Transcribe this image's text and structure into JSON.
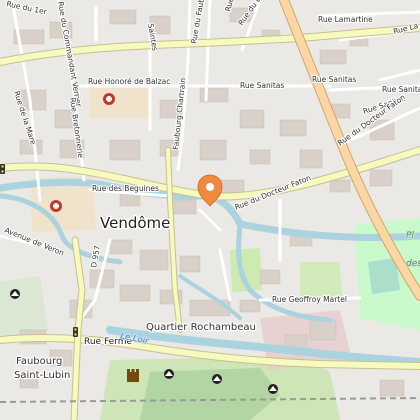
{
  "map": {
    "town": "Vendôme",
    "districts": [
      "Quartier Rochambeau",
      "Faubourg",
      "Saint-Lubin"
    ],
    "streets": {
      "rue_1er": "Rue du 1er",
      "commandant_verrier": "Rue du Commandant Verrier",
      "honore_balzac": "Rue Honoré de Balzac",
      "lamartine": "Rue Lamartine",
      "la_top": "Rue La",
      "faub": "Rue du Faub",
      "saintes": "Saintes",
      "rue_de_r": "Rue de R",
      "rue_du_bo": "Rue du Bo",
      "sanitas": "Rue Sanitas",
      "sanitas_2": "Rue Sanitas",
      "sanitas_3": "Rue Sanitas",
      "sanitas_4": "Rue Sanitas",
      "faubourg_chartrain": "Faubourg Chartrain",
      "de_la_mare": "Rue de la Mare",
      "bretonnerie": "Rue Bretonnerie",
      "beguines": "Rue des Beguines",
      "docteur_faton": "Rue du Docteur Faton",
      "docteur_faton_2": "Rue du Docteur Faton",
      "avenue_veron": "Avenue de Veron",
      "d957": "D 957",
      "geoffroy_martel": "Rue Geoffroy Martel",
      "ferme": "Rue Ferme"
    },
    "water": {
      "le_loir": "Le Loir"
    },
    "park": {
      "p": "Pl",
      "des": "des"
    },
    "markers": [
      {
        "name": "hospital",
        "icon": "hospital-icon"
      },
      {
        "name": "hospital",
        "icon": "hospital-icon"
      },
      {
        "name": "selected-location",
        "icon": "map-pin-icon",
        "color": "#f08a40"
      },
      {
        "name": "viewpoint",
        "icon": "viewpoint-icon"
      },
      {
        "name": "castle",
        "icon": "castle-icon"
      }
    ],
    "colors": {
      "background": "#f2efe9",
      "water": "#aad3df",
      "major_road": "#f7fabf",
      "trunk_road": "#fcd6a4",
      "park": "#c8facc",
      "buildings": "#d9d0c9",
      "marker": "#f08a40",
      "hospital": "#c0392b"
    }
  }
}
